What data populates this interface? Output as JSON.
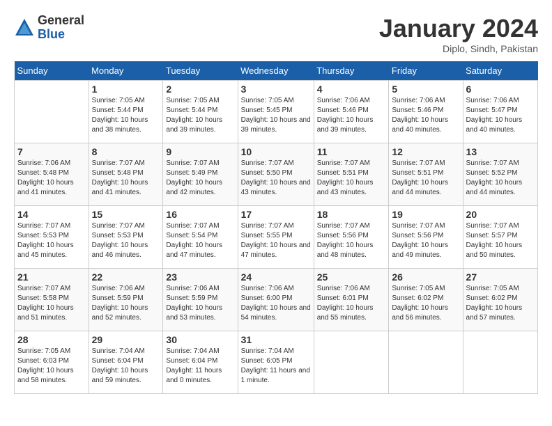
{
  "logo": {
    "general": "General",
    "blue": "Blue"
  },
  "title": {
    "month": "January 2024",
    "location": "Diplo, Sindh, Pakistan"
  },
  "days_of_week": [
    "Sunday",
    "Monday",
    "Tuesday",
    "Wednesday",
    "Thursday",
    "Friday",
    "Saturday"
  ],
  "weeks": [
    [
      null,
      {
        "day": 1,
        "sunrise": "7:05 AM",
        "sunset": "5:44 PM",
        "daylight": "10 hours and 38 minutes."
      },
      {
        "day": 2,
        "sunrise": "7:05 AM",
        "sunset": "5:44 PM",
        "daylight": "10 hours and 39 minutes."
      },
      {
        "day": 3,
        "sunrise": "7:05 AM",
        "sunset": "5:45 PM",
        "daylight": "10 hours and 39 minutes."
      },
      {
        "day": 4,
        "sunrise": "7:06 AM",
        "sunset": "5:46 PM",
        "daylight": "10 hours and 39 minutes."
      },
      {
        "day": 5,
        "sunrise": "7:06 AM",
        "sunset": "5:46 PM",
        "daylight": "10 hours and 40 minutes."
      },
      {
        "day": 6,
        "sunrise": "7:06 AM",
        "sunset": "5:47 PM",
        "daylight": "10 hours and 40 minutes."
      }
    ],
    [
      {
        "day": 7,
        "sunrise": "7:06 AM",
        "sunset": "5:48 PM",
        "daylight": "10 hours and 41 minutes."
      },
      {
        "day": 8,
        "sunrise": "7:07 AM",
        "sunset": "5:48 PM",
        "daylight": "10 hours and 41 minutes."
      },
      {
        "day": 9,
        "sunrise": "7:07 AM",
        "sunset": "5:49 PM",
        "daylight": "10 hours and 42 minutes."
      },
      {
        "day": 10,
        "sunrise": "7:07 AM",
        "sunset": "5:50 PM",
        "daylight": "10 hours and 43 minutes."
      },
      {
        "day": 11,
        "sunrise": "7:07 AM",
        "sunset": "5:51 PM",
        "daylight": "10 hours and 43 minutes."
      },
      {
        "day": 12,
        "sunrise": "7:07 AM",
        "sunset": "5:51 PM",
        "daylight": "10 hours and 44 minutes."
      },
      {
        "day": 13,
        "sunrise": "7:07 AM",
        "sunset": "5:52 PM",
        "daylight": "10 hours and 44 minutes."
      }
    ],
    [
      {
        "day": 14,
        "sunrise": "7:07 AM",
        "sunset": "5:53 PM",
        "daylight": "10 hours and 45 minutes."
      },
      {
        "day": 15,
        "sunrise": "7:07 AM",
        "sunset": "5:53 PM",
        "daylight": "10 hours and 46 minutes."
      },
      {
        "day": 16,
        "sunrise": "7:07 AM",
        "sunset": "5:54 PM",
        "daylight": "10 hours and 47 minutes."
      },
      {
        "day": 17,
        "sunrise": "7:07 AM",
        "sunset": "5:55 PM",
        "daylight": "10 hours and 47 minutes."
      },
      {
        "day": 18,
        "sunrise": "7:07 AM",
        "sunset": "5:56 PM",
        "daylight": "10 hours and 48 minutes."
      },
      {
        "day": 19,
        "sunrise": "7:07 AM",
        "sunset": "5:56 PM",
        "daylight": "10 hours and 49 minutes."
      },
      {
        "day": 20,
        "sunrise": "7:07 AM",
        "sunset": "5:57 PM",
        "daylight": "10 hours and 50 minutes."
      }
    ],
    [
      {
        "day": 21,
        "sunrise": "7:07 AM",
        "sunset": "5:58 PM",
        "daylight": "10 hours and 51 minutes."
      },
      {
        "day": 22,
        "sunrise": "7:06 AM",
        "sunset": "5:59 PM",
        "daylight": "10 hours and 52 minutes."
      },
      {
        "day": 23,
        "sunrise": "7:06 AM",
        "sunset": "5:59 PM",
        "daylight": "10 hours and 53 minutes."
      },
      {
        "day": 24,
        "sunrise": "7:06 AM",
        "sunset": "6:00 PM",
        "daylight": "10 hours and 54 minutes."
      },
      {
        "day": 25,
        "sunrise": "7:06 AM",
        "sunset": "6:01 PM",
        "daylight": "10 hours and 55 minutes."
      },
      {
        "day": 26,
        "sunrise": "7:05 AM",
        "sunset": "6:02 PM",
        "daylight": "10 hours and 56 minutes."
      },
      {
        "day": 27,
        "sunrise": "7:05 AM",
        "sunset": "6:02 PM",
        "daylight": "10 hours and 57 minutes."
      }
    ],
    [
      {
        "day": 28,
        "sunrise": "7:05 AM",
        "sunset": "6:03 PM",
        "daylight": "10 hours and 58 minutes."
      },
      {
        "day": 29,
        "sunrise": "7:04 AM",
        "sunset": "6:04 PM",
        "daylight": "10 hours and 59 minutes."
      },
      {
        "day": 30,
        "sunrise": "7:04 AM",
        "sunset": "6:04 PM",
        "daylight": "11 hours and 0 minutes."
      },
      {
        "day": 31,
        "sunrise": "7:04 AM",
        "sunset": "6:05 PM",
        "daylight": "11 hours and 1 minute."
      },
      null,
      null,
      null
    ]
  ]
}
